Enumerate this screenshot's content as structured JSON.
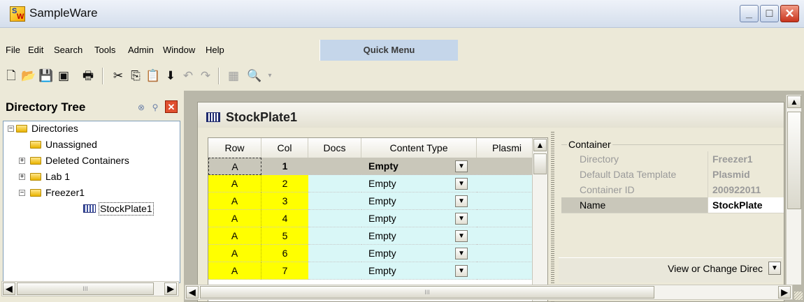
{
  "window": {
    "title": "SampleWare",
    "icon": "sampleware-logo",
    "icon_text": "SW"
  },
  "menu": {
    "items": [
      "File",
      "Edit",
      "Search",
      "Tools",
      "Admin",
      "Window",
      "Help"
    ],
    "quick_menu": "Quick Menu"
  },
  "toolbar": {
    "buttons": [
      {
        "icon": "new-document-icon",
        "glyph": "🗋"
      },
      {
        "icon": "open-folder-icon",
        "glyph": "📂"
      },
      {
        "icon": "save-icon",
        "glyph": "💾"
      },
      {
        "icon": "save-all-icon",
        "glyph": "▣"
      },
      {
        "icon": "print-icon",
        "glyph": "🖶"
      },
      {
        "icon": "cut-icon",
        "glyph": "✂"
      },
      {
        "icon": "copy-icon",
        "glyph": "⎘"
      },
      {
        "icon": "paste-icon",
        "glyph": "📋"
      },
      {
        "icon": "insert-down-icon",
        "glyph": "⬇"
      },
      {
        "icon": "undo-icon",
        "glyph": "↶"
      },
      {
        "icon": "redo-icon",
        "glyph": "↷"
      },
      {
        "icon": "grid-view-icon",
        "glyph": "▦"
      },
      {
        "icon": "find-icon",
        "glyph": "🔍"
      }
    ]
  },
  "directory_tree": {
    "title": "Directory Tree",
    "nodes": [
      {
        "label": "Directories",
        "expander": "−"
      },
      {
        "label": "Unassigned",
        "expander": ""
      },
      {
        "label": "Deleted Containers",
        "expander": "+"
      },
      {
        "label": "Lab 1",
        "expander": "+"
      },
      {
        "label": "Freezer1",
        "expander": "−"
      },
      {
        "label": "StockPlate1",
        "expander": ""
      }
    ],
    "hscroll_thumb": "III"
  },
  "document": {
    "title": "StockPlate1",
    "grid": {
      "columns": [
        "Row",
        "Col",
        "Docs",
        "Content Type",
        "Plasmi"
      ],
      "rows": [
        {
          "row": "A",
          "col": "1",
          "docs": "",
          "type": "Empty"
        },
        {
          "row": "A",
          "col": "2",
          "docs": "",
          "type": "Empty"
        },
        {
          "row": "A",
          "col": "3",
          "docs": "",
          "type": "Empty"
        },
        {
          "row": "A",
          "col": "4",
          "docs": "",
          "type": "Empty"
        },
        {
          "row": "A",
          "col": "5",
          "docs": "",
          "type": "Empty"
        },
        {
          "row": "A",
          "col": "6",
          "docs": "",
          "type": "Empty"
        },
        {
          "row": "A",
          "col": "7",
          "docs": "",
          "type": "Empty"
        }
      ],
      "hscroll_thumb": "III"
    },
    "properties": {
      "group": "Container",
      "rows": [
        {
          "key": "Directory",
          "value": "Freezer1"
        },
        {
          "key": "Default Data Template",
          "value": "Plasmid"
        },
        {
          "key": "Container ID",
          "value": "200922011"
        },
        {
          "key": "Name",
          "value": "StockPlate"
        }
      ],
      "view_button": "View or Change Direc"
    }
  },
  "colors": {
    "row_highlight": "#ffff00",
    "cell_tint": "#d9f7f7",
    "selected_row": "#c9c7ba",
    "quick_menu_bg": "#c5d6ea"
  }
}
